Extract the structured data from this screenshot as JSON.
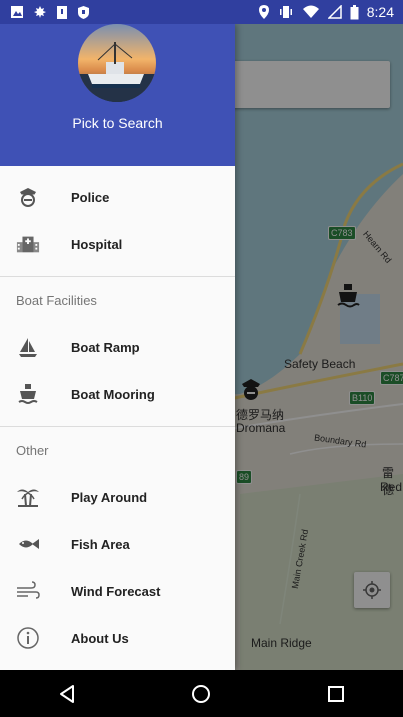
{
  "status_bar": {
    "time": "8:24",
    "left_icons": [
      "image-icon",
      "leaf-icon",
      "sd-card-icon",
      "shield-icon"
    ],
    "right_icons": [
      "location-icon",
      "vibrate-icon",
      "wifi-icon",
      "signal-icon",
      "battery-icon"
    ]
  },
  "drawer": {
    "header": {
      "title": "Pick to Search"
    },
    "items": [
      {
        "label": "Police",
        "icon": "police-icon"
      },
      {
        "label": "Hospital",
        "icon": "hospital-icon"
      }
    ],
    "sections": [
      {
        "title": "Boat Facilities",
        "items": [
          {
            "label": "Boat Ramp",
            "icon": "sailboat-icon"
          },
          {
            "label": "Boat Mooring",
            "icon": "boat-icon"
          }
        ]
      },
      {
        "title": "Other",
        "items": [
          {
            "label": "Play Around",
            "icon": "palm-tree-icon"
          },
          {
            "label": "Fish Area",
            "icon": "fish-icon"
          },
          {
            "label": "Wind Forecast",
            "icon": "wind-icon"
          },
          {
            "label": "About Us",
            "icon": "info-icon"
          }
        ]
      }
    ]
  },
  "map": {
    "labels": {
      "safety_beach": "Safety Beach",
      "dromana_cn": "德罗马纳",
      "dromana": "Dromana",
      "boundary_rd": "Boundary Rd",
      "main_creek_rd": "Main Creek Rd",
      "main_ridge": "Main Ridge",
      "red_hill_cn": "雷德",
      "red_hill": "Red",
      "hearn_rd": "Hearn Rd"
    },
    "road_badges": [
      "C783",
      "C787",
      "B110",
      "89"
    ]
  },
  "nav_bar": {
    "icons": [
      "back-icon",
      "home-icon",
      "recents-icon"
    ]
  },
  "colors": {
    "primary": "#3f51b5",
    "primary_dark": "#303f9f",
    "water": "#aad3df"
  }
}
